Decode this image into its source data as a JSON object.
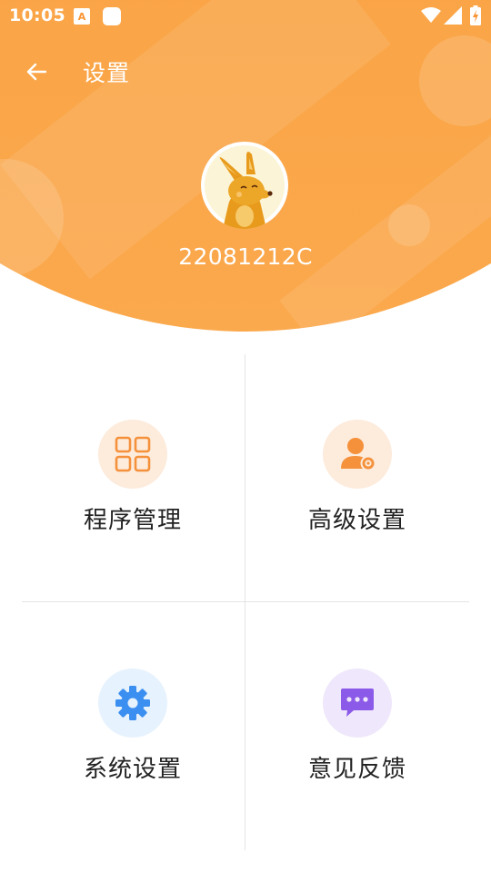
{
  "status_bar": {
    "time": "10:05",
    "icons": [
      "a-keyboard-icon",
      "notification-icon",
      "wifi-icon",
      "signal-icon",
      "battery-charging-icon"
    ]
  },
  "app_bar": {
    "title": "设置",
    "back_icon": "arrow-left-icon"
  },
  "profile": {
    "username": "22081212C",
    "avatar_icon": "kangaroo-avatar"
  },
  "colors": {
    "header_orange": "#f99533",
    "accent_orange": "#f5913b",
    "system_blue": "#3b8ff0",
    "feedback_purple": "#8c5ae8"
  },
  "menu": {
    "items": [
      {
        "label": "程序管理",
        "icon": "grid-apps-icon",
        "icon_bg": "#fdebdc"
      },
      {
        "label": "高级设置",
        "icon": "user-gear-icon",
        "icon_bg": "#fdebdc"
      },
      {
        "label": "系统设置",
        "icon": "gear-icon",
        "icon_bg": "#e6f2fd"
      },
      {
        "label": "意见反馈",
        "icon": "chat-bubble-icon",
        "icon_bg": "#efe7fb"
      }
    ]
  }
}
